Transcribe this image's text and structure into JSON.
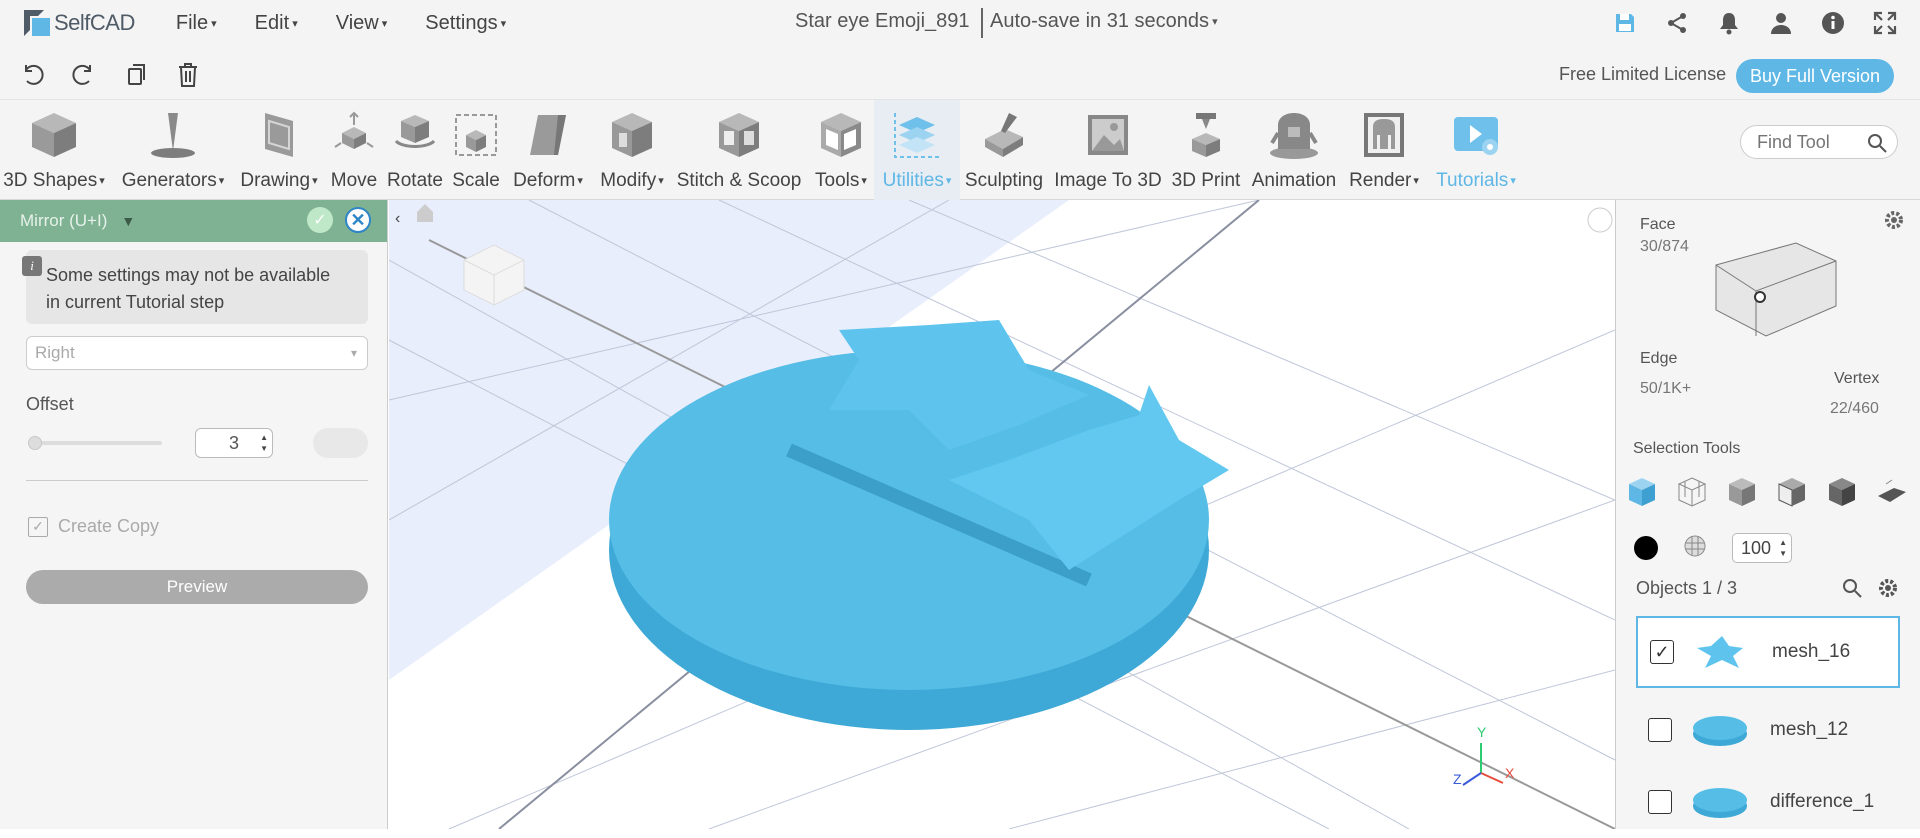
{
  "app": {
    "name": "SelfCAD"
  },
  "menu": [
    "File",
    "Edit",
    "View",
    "Settings"
  ],
  "document": {
    "title": "Star eye Emoji_891",
    "autosave": "Auto-save in 31 seconds"
  },
  "license": {
    "label": "Free Limited License",
    "buy": "Buy Full Version"
  },
  "tools": [
    {
      "label": "3D Shapes",
      "dd": true
    },
    {
      "label": "Generators",
      "dd": true
    },
    {
      "label": "Drawing",
      "dd": true
    },
    {
      "label": "Move",
      "dd": false
    },
    {
      "label": "Rotate",
      "dd": false
    },
    {
      "label": "Scale",
      "dd": false
    },
    {
      "label": "Deform",
      "dd": true
    },
    {
      "label": "Modify",
      "dd": true
    },
    {
      "label": "Stitch & Scoop",
      "dd": false
    },
    {
      "label": "Tools",
      "dd": true
    },
    {
      "label": "Utilities",
      "dd": true
    },
    {
      "label": "Sculpting",
      "dd": false
    },
    {
      "label": "Image To 3D",
      "dd": false
    },
    {
      "label": "3D Print",
      "dd": false
    },
    {
      "label": "Animation",
      "dd": false
    },
    {
      "label": "Render",
      "dd": true
    },
    {
      "label": "Tutorials",
      "dd": true
    }
  ],
  "find_tool": {
    "placeholder": "Find Tool"
  },
  "panel": {
    "title": "Mirror (U+I)",
    "note": "Some settings may not be available in current Tutorial step",
    "direction": "Right",
    "offset_label": "Offset",
    "offset_value": "3",
    "create_copy": "Create Copy",
    "preview": "Preview"
  },
  "selection": {
    "face": "Face",
    "face_count": "30/874",
    "edge": "Edge",
    "edge_count": "50/1K+",
    "vertex": "Vertex",
    "vertex_count": "22/460",
    "tools_label": "Selection Tools",
    "opacity": "100"
  },
  "objects": {
    "label": "Objects 1 / 3",
    "items": [
      {
        "name": "mesh_16",
        "checked": true
      },
      {
        "name": "mesh_12",
        "checked": false
      },
      {
        "name": "difference_1",
        "checked": false
      }
    ]
  },
  "axes": {
    "x": "X",
    "y": "Y",
    "z": "Z"
  },
  "colors": {
    "accent": "#5fb7e6",
    "panel_header": "#7fb193",
    "object": "#4fb8e2"
  }
}
